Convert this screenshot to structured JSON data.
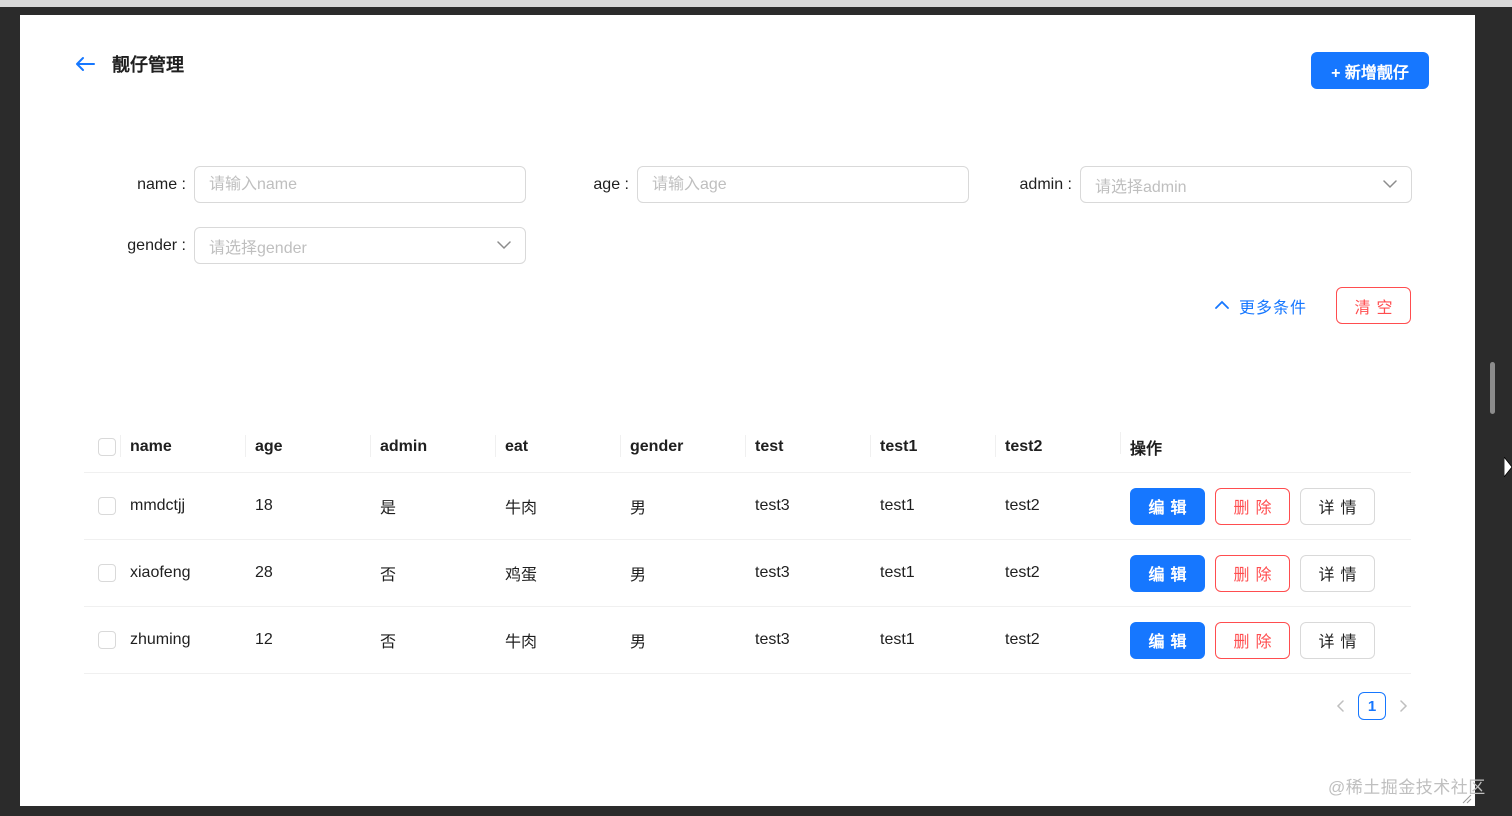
{
  "header": {
    "title": "靓仔管理",
    "add_button_label": "+ 新增靓仔"
  },
  "filters": {
    "name": {
      "label": "name :",
      "placeholder": "请输入name"
    },
    "age": {
      "label": "age :",
      "placeholder": "请输入age"
    },
    "admin": {
      "label": "admin :",
      "placeholder": "请选择admin"
    },
    "gender": {
      "label": "gender :",
      "placeholder": "请选择gender"
    },
    "more_label": "更多条件",
    "clear_label": "清空"
  },
  "table": {
    "columns": [
      "name",
      "age",
      "admin",
      "eat",
      "gender",
      "test",
      "test1",
      "test2",
      "操作"
    ],
    "rows": [
      {
        "name": "mmdctjj",
        "age": "18",
        "admin": "是",
        "eat": "牛肉",
        "gender": "男",
        "test": "test3",
        "test1": "test1",
        "test2": "test2"
      },
      {
        "name": "xiaofeng",
        "age": "28",
        "admin": "否",
        "eat": "鸡蛋",
        "gender": "男",
        "test": "test3",
        "test1": "test1",
        "test2": "test2"
      },
      {
        "name": "zhuming",
        "age": "12",
        "admin": "否",
        "eat": "牛肉",
        "gender": "男",
        "test": "test3",
        "test1": "test1",
        "test2": "test2"
      }
    ],
    "actions": {
      "edit": "编辑",
      "delete": "删除",
      "detail": "详情"
    }
  },
  "pagination": {
    "current_page": "1"
  },
  "watermark": "@稀土掘金技术社区",
  "colors": {
    "primary": "#1677ff",
    "danger": "#ff4d4f",
    "border": "#d9d9d9"
  },
  "icons": {
    "back": "arrow-left-icon",
    "select": "chevron-down-icon",
    "more": "chevron-up-icon",
    "prev": "chevron-left-icon",
    "next": "chevron-right-icon"
  }
}
